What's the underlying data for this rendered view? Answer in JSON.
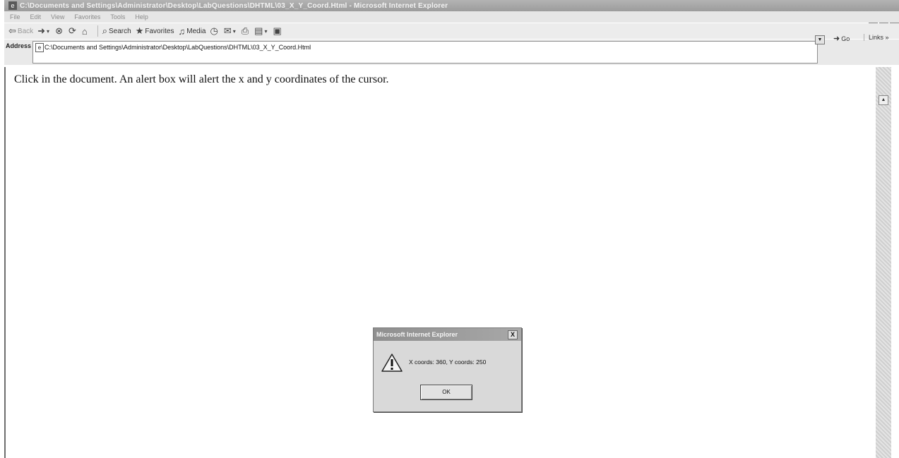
{
  "window": {
    "title": "C:\\Documents and Settings\\Administrator\\Desktop\\LabQuestions\\DHTML\\03_X_Y_Coord.Html - Microsoft Internet Explorer",
    "controls": {
      "minimize": "_",
      "maximize": "□",
      "close": "x"
    }
  },
  "menubar": {
    "items": [
      "File",
      "Edit",
      "View",
      "Favorites",
      "Tools",
      "Help"
    ]
  },
  "toolbar": {
    "back_label": "Back",
    "search_label": "Search",
    "favorites_label": "Favorites",
    "media_label": "Media"
  },
  "addressbar": {
    "label": "Address",
    "url": "C:\\Documents and Settings\\Administrator\\Desktop\\LabQuestions\\DHTML\\03_X_Y_Coord.Html",
    "go_label": "Go",
    "links_label": "Links »"
  },
  "content": {
    "text": "Click in the document. An alert box will alert the x and y coordinates of the cursor."
  },
  "alert": {
    "title": "Microsoft Internet Explorer",
    "message": "X coords: 360, Y coords: 250",
    "ok_label": "OK",
    "close_label": "X"
  },
  "icons": {
    "title_icon": "ie-page-icon",
    "dialog_icon": "warning-icon"
  }
}
